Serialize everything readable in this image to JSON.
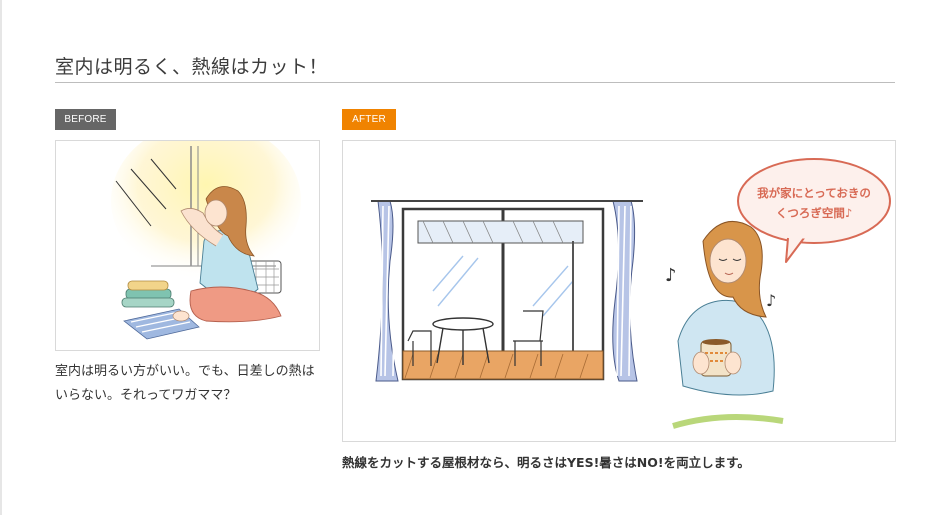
{
  "section": {
    "title": "室内は明るく、熱線はカット！"
  },
  "before": {
    "label": "BEFORE",
    "label_color": "#666666",
    "caption": "室内は明るい方がいい。でも、日差しの熱はいらない。それってワガママ？"
  },
  "after": {
    "label": "AFTER",
    "label_color": "#f08300",
    "caption": "熱線をカットする屋根材なら、明るさはYES!暑さはNO!を両立します。",
    "speech_bubble": {
      "line1": "我が家にとっておきの",
      "line2": "くつろぎ空間♪"
    }
  }
}
